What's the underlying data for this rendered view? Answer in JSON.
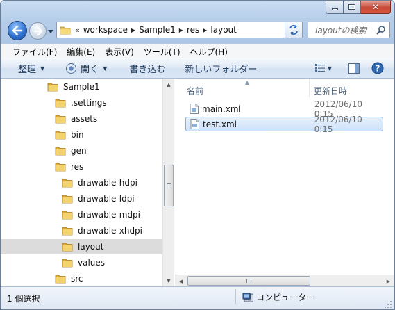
{
  "window": {
    "caption": {
      "minimize": "–",
      "maximize": "□",
      "close": "✕"
    }
  },
  "address_bar": {
    "overflow": "«",
    "crumbs": [
      "workspace",
      "Sample1",
      "res",
      "layout"
    ],
    "search_placeholder": "layoutの検索"
  },
  "menu": [
    "ファイル(F)",
    "編集(E)",
    "表示(V)",
    "ツール(T)",
    "ヘルプ(H)"
  ],
  "toolbar": {
    "organize": "整理",
    "open": "開く",
    "burn": "書き込む",
    "new_folder": "新しいフォルダー"
  },
  "tree": {
    "items": [
      {
        "label": "Sample1",
        "depth": 0
      },
      {
        "label": ".settings",
        "depth": 1
      },
      {
        "label": "assets",
        "depth": 1
      },
      {
        "label": "bin",
        "depth": 1
      },
      {
        "label": "gen",
        "depth": 1
      },
      {
        "label": "res",
        "depth": 1
      },
      {
        "label": "drawable-hdpi",
        "depth": 2
      },
      {
        "label": "drawable-ldpi",
        "depth": 2
      },
      {
        "label": "drawable-mdpi",
        "depth": 2
      },
      {
        "label": "drawable-xhdpi",
        "depth": 2
      },
      {
        "label": "layout",
        "depth": 2,
        "selected": true
      },
      {
        "label": "values",
        "depth": 2
      },
      {
        "label": "src",
        "depth": 1
      }
    ]
  },
  "files": {
    "columns": {
      "name": "名前",
      "date": "更新日時"
    },
    "rows": [
      {
        "name": "main.xml",
        "date": "2012/06/10 0:15",
        "selected": false
      },
      {
        "name": "test.xml",
        "date": "2012/06/10 0:15",
        "selected": true
      }
    ]
  },
  "status": {
    "selection": "1 個選択",
    "location": "コンピューター"
  },
  "colors": {
    "frame": "#b5cde9",
    "selection_bg": "#cfe2f9",
    "selection_border": "#84acdd",
    "folder": "#e8c25a"
  }
}
